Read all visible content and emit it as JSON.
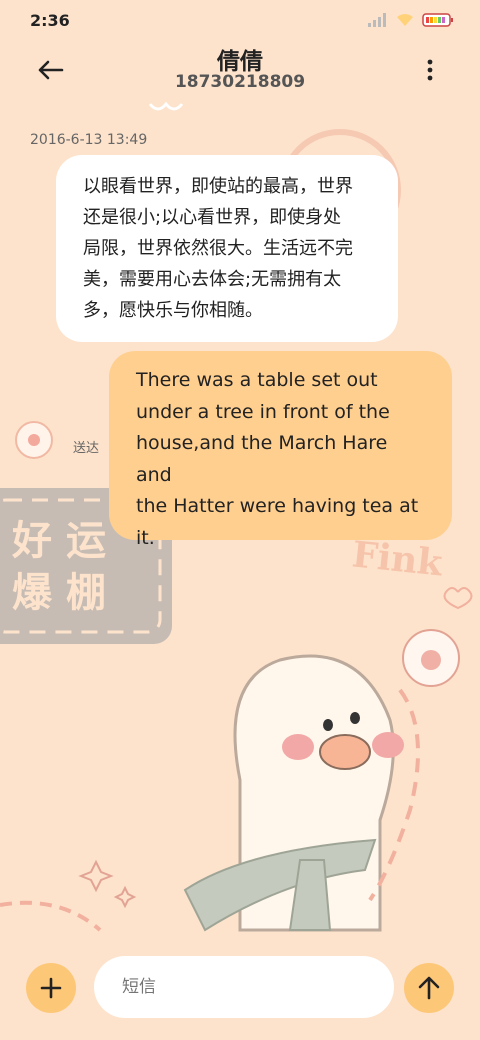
{
  "status_bar": {
    "time": "2:36",
    "icons": [
      "signal-icon",
      "wifi-icon",
      "battery-icon"
    ]
  },
  "header": {
    "contact_name": "倩倩",
    "phone_number": "18730218809"
  },
  "messages": [
    {
      "timestamp": "2016-6-13 13:49",
      "direction": "incoming",
      "lines": [
        "以眼看世界，即使站的最高，世界",
        "还是很小;以心看世界，即使身处",
        "局限，世界依然很大。生活远不完",
        "美，需要用心去体会;无需拥有太",
        "多，愿快乐与你相随。"
      ]
    },
    {
      "direction": "outgoing",
      "lines": [
        "There was a table set out",
        "under a tree in front of the",
        "house,and the March Hare and",
        "the Hatter were having tea at",
        "it."
      ],
      "status": "送达"
    }
  ],
  "wallpaper": {
    "logo_line1": "好运",
    "logo_line2": "爆棚",
    "signature": "Fink"
  },
  "composer": {
    "placeholder": "短信"
  },
  "colors": {
    "background": "#fde3cc",
    "outgoing_bubble": "#ffcf8f",
    "incoming_bubble": "#ffffff",
    "accent_button": "#fdc778"
  }
}
